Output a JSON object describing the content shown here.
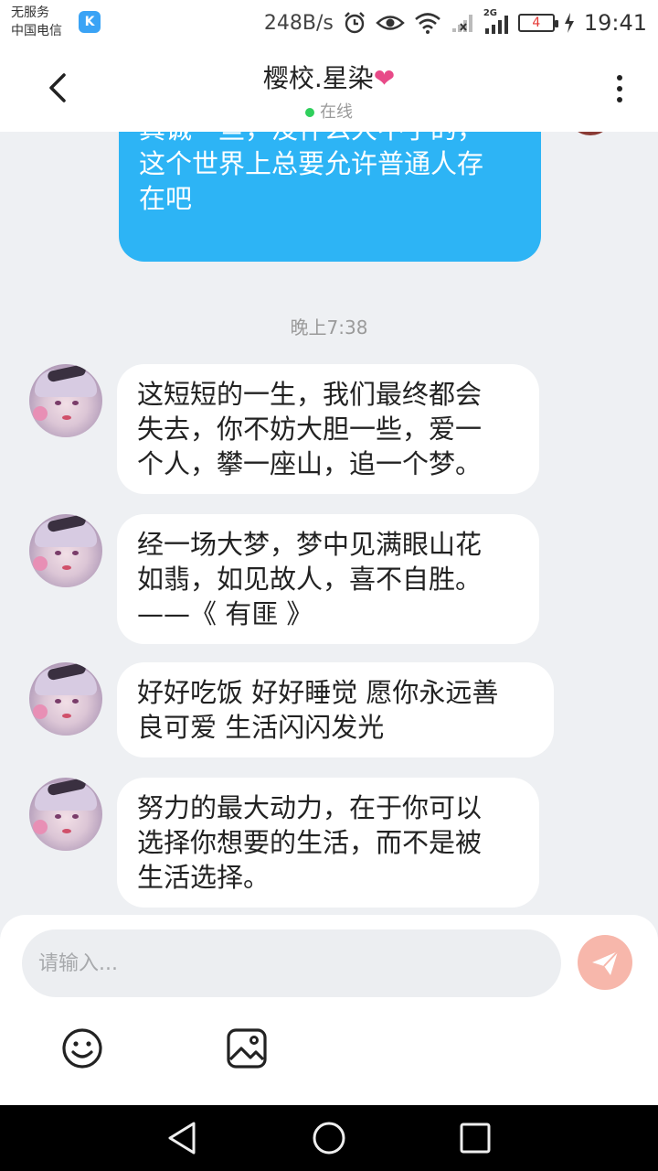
{
  "status_bar": {
    "carrier_line1": "无服务",
    "carrier_line2": "中国电信",
    "k_icon_text": "K",
    "net_speed": "248B/s",
    "network_label": "2G",
    "battery_level": "4",
    "time": "19:41",
    "icons": [
      "alarm-icon",
      "eye-icon",
      "wifi-icon",
      "no-signal-icon",
      "signal-2g-icon",
      "battery-icon",
      "charging-icon"
    ]
  },
  "header": {
    "title": "樱校.星染",
    "title_suffix": "❤",
    "status": "在线",
    "status_color": "#2fcf5c"
  },
  "chat": {
    "outgoing_partial": "换色会，但是我一定要快乐和\n真诚一些，没什么大不了的，\n这个世界上总要允许普通人存\n在吧",
    "timestamp": "晚上7:38",
    "messages": [
      {
        "text": "这短短的一生，我们最终都会\n失去，你不妨大胆一些，爱一\n个人，攀一座山，追一个梦。"
      },
      {
        "text": "经一场大梦，梦中见满眼山花\n如翡，如见故人，喜不自胜。\n——《 有匪 》"
      },
      {
        "text": "好好吃饭 好好睡觉 愿你永远善\n良可爱 生活闪闪发光"
      },
      {
        "text": "努力的最大动力，在于你可以\n选择你想要的生活，而不是被\n生活选择。"
      }
    ],
    "outgoing_color": "#2db4f5"
  },
  "composer": {
    "placeholder": "请输入...",
    "send_color": "#f7b7ab"
  }
}
